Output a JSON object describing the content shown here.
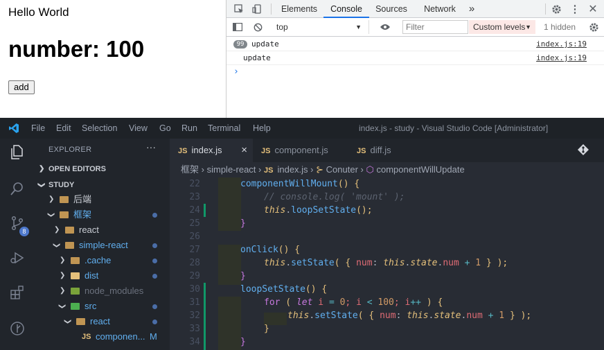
{
  "page": {
    "hello": "Hello World",
    "number_text": "number: 100",
    "add_label": "add"
  },
  "devtools": {
    "tabs": [
      "Elements",
      "Console",
      "Sources",
      "Network"
    ],
    "more_tabs": "»",
    "context": "top",
    "filter_placeholder": "Filter",
    "levels": "Custom levels",
    "hidden": "1 hidden",
    "logs": [
      {
        "count": "99",
        "text": "update",
        "source": "index.js:19"
      },
      {
        "count": "",
        "text": "update",
        "source": "index.js:19"
      }
    ],
    "prompt": "›"
  },
  "vscode": {
    "menu": [
      "File",
      "Edit",
      "Selection",
      "View",
      "Go",
      "Run",
      "Terminal",
      "Help"
    ],
    "title": "index.js - study - Visual Studio Code [Administrator]",
    "explorer_title": "EXPLORER",
    "explorer_more": "···",
    "source_control_badge": "8",
    "tree": {
      "open_editors": "OPEN EDITORS",
      "study": "STUDY",
      "houduan": "后端",
      "kuangjia": "框架",
      "react": "react",
      "simple_react": "simple-react",
      "cache": ".cache",
      "dist": "dist",
      "node_modules": "node_modules",
      "src": "src",
      "src_react": "react",
      "component_file": "componen...",
      "modified": "M"
    },
    "tabs": [
      {
        "label": "index.js",
        "close": "×"
      },
      {
        "label": "component.js"
      },
      {
        "label": "diff.js"
      }
    ],
    "tab_js": "JS",
    "breadcrumb": {
      "c1": "框架",
      "c2": "simple-react",
      "c3": "index.js",
      "c4": "Conuter",
      "c5": "componentWillUpdate"
    },
    "line_numbers": [
      "22",
      "23",
      "24",
      "25",
      "26",
      "27",
      "28",
      "29",
      "30",
      "31",
      "32",
      "33",
      "34"
    ],
    "code": {
      "l22a": "componentWillMount",
      "l22b": "() {",
      "l23": "// console.log( 'mount' );",
      "l24a": "this",
      "l24b": ".",
      "l24c": "loopSetState",
      "l24d": "();",
      "l25": "}",
      "l27a": "onClick",
      "l27b": "() {",
      "l28a": "this",
      "l28b": ".",
      "l28c": "setState",
      "l28d": "( { ",
      "l28e": "num",
      "l28f": ": ",
      "l28g": "this",
      "l28h": ".",
      "l28i": "state",
      "l28j": ".",
      "l28k": "num",
      "l28l": " + ",
      "l28m": "1",
      "l28n": " } );",
      "l29": "}",
      "l30a": "loopSetState",
      "l30b": "() {",
      "l31a": "for",
      "l31b": " ( ",
      "l31c": "let",
      "l31d": " i ",
      "l31e": "=",
      "l31f": " 0",
      "l31g": "; i ",
      "l31h": "<",
      "l31i": " 100",
      "l31j": "; i",
      "l31k": "++",
      "l31l": " ) {",
      "l32a": "this",
      "l32b": ".",
      "l32c": "setState",
      "l32d": "( { ",
      "l32e": "num",
      "l32f": ": ",
      "l32g": "this",
      "l32h": ".",
      "l32i": "state",
      "l32j": ".",
      "l32k": "num",
      "l32l": " + ",
      "l32m": "1",
      "l32n": " } );",
      "l33": "}",
      "l34": "}"
    }
  }
}
